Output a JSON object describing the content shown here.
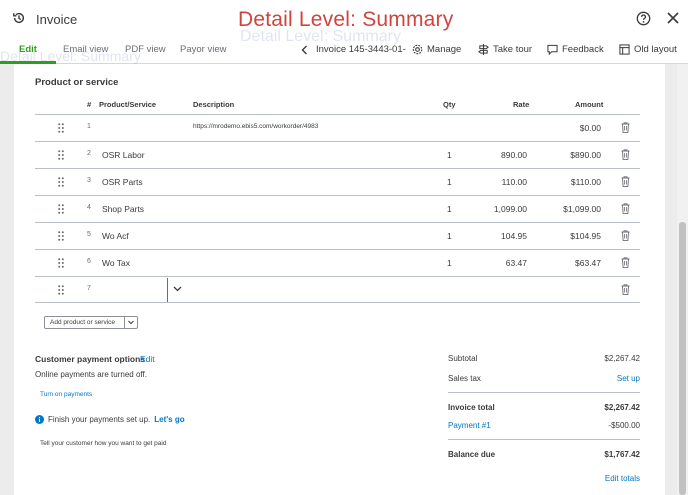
{
  "header": {
    "app_title": "Invoice",
    "overlay_title": "Detail Level: Summary"
  },
  "tabs": [
    {
      "label": "Edit",
      "active": true
    },
    {
      "label": "Email view"
    },
    {
      "label": "PDF view"
    },
    {
      "label": "Payor view"
    }
  ],
  "toolbar": {
    "invoice_label": "Invoice 145-3443-01-",
    "manage": "Manage",
    "take_tour": "Take tour",
    "feedback": "Feedback",
    "old_layout": "Old layout"
  },
  "section_title": "Product or service",
  "table": {
    "headers": {
      "num": "#",
      "product": "Product/Service",
      "description": "Description",
      "qty": "Qty",
      "rate": "Rate",
      "amount": "Amount"
    },
    "rows": [
      {
        "num": "1",
        "product": "",
        "description": "https://mrodemo.ebis5.com/workorder/4983",
        "qty": "",
        "rate": "",
        "amount": "$0.00"
      },
      {
        "num": "2",
        "product": "OSR Labor",
        "description": "",
        "qty": "1",
        "rate": "890.00",
        "amount": "$890.00"
      },
      {
        "num": "3",
        "product": "OSR Parts",
        "description": "",
        "qty": "1",
        "rate": "110.00",
        "amount": "$110.00"
      },
      {
        "num": "4",
        "product": "Shop Parts",
        "description": "",
        "qty": "1",
        "rate": "1,099.00",
        "amount": "$1,099.00"
      },
      {
        "num": "5",
        "product": "Wo Acf",
        "description": "",
        "qty": "1",
        "rate": "104.95",
        "amount": "$104.95"
      },
      {
        "num": "6",
        "product": "Wo Tax",
        "description": "",
        "qty": "1",
        "rate": "63.47",
        "amount": "$63.47"
      },
      {
        "num": "7",
        "product": "",
        "description": "",
        "qty": "",
        "rate": "",
        "amount": ""
      }
    ]
  },
  "add_button": "Add product or service",
  "payment": {
    "title": "Customer payment options",
    "edit": "Edit",
    "status": "Online payments are turned off.",
    "turn_on": "Turn on payments",
    "finish": "Finish your payments set up.",
    "lets_go": "Let's go",
    "tell": "Tell your customer how you want to get paid"
  },
  "totals": {
    "subtotal_label": "Subtotal",
    "subtotal": "$2,267.42",
    "sales_tax_label": "Sales tax",
    "set_up": "Set up",
    "invoice_total_label": "Invoice total",
    "invoice_total": "$2,267.42",
    "payment_label": "Payment #1",
    "payment": "-$500.00",
    "balance_due_label": "Balance due",
    "balance_due": "$1,767.42",
    "edit_totals": "Edit totals"
  },
  "colors": {
    "accent_green": "#2ca01c",
    "link_blue": "#0077c5",
    "overlay_red": "#d0443e"
  }
}
